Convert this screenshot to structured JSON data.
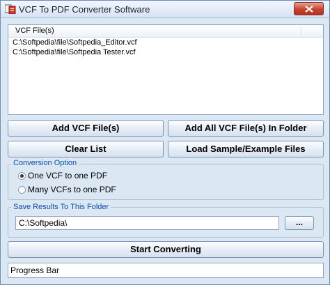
{
  "window": {
    "title": "VCF To PDF Converter Software",
    "close_icon": "close-icon",
    "app_icon": "vcf-pdf-app-icon"
  },
  "file_list": {
    "header": "VCF File(s)",
    "items": [
      "C:\\Softpedia\\file\\Softpedia_Editor.vcf",
      "C:\\Softpedia\\file\\Softpedia Tester.vcf"
    ]
  },
  "buttons": {
    "add_files": "Add VCF File(s)",
    "add_folder": "Add All VCF File(s) In Folder",
    "clear_list": "Clear List",
    "load_sample": "Load Sample/Example Files",
    "browse": "...",
    "start": "Start Converting"
  },
  "conversion": {
    "legend": "Conversion Option",
    "options": [
      "One VCF to one PDF",
      "Many VCFs to one PDF"
    ],
    "selected": "One VCF to one PDF"
  },
  "save": {
    "legend": "Save Results To This Folder",
    "folder": "C:\\Softpedia\\"
  },
  "progress": {
    "label": "Progress Bar"
  },
  "colors": {
    "window_bg": "#dce7f4",
    "legend_text": "#0b4fa6",
    "close_red": "#c4432f"
  }
}
